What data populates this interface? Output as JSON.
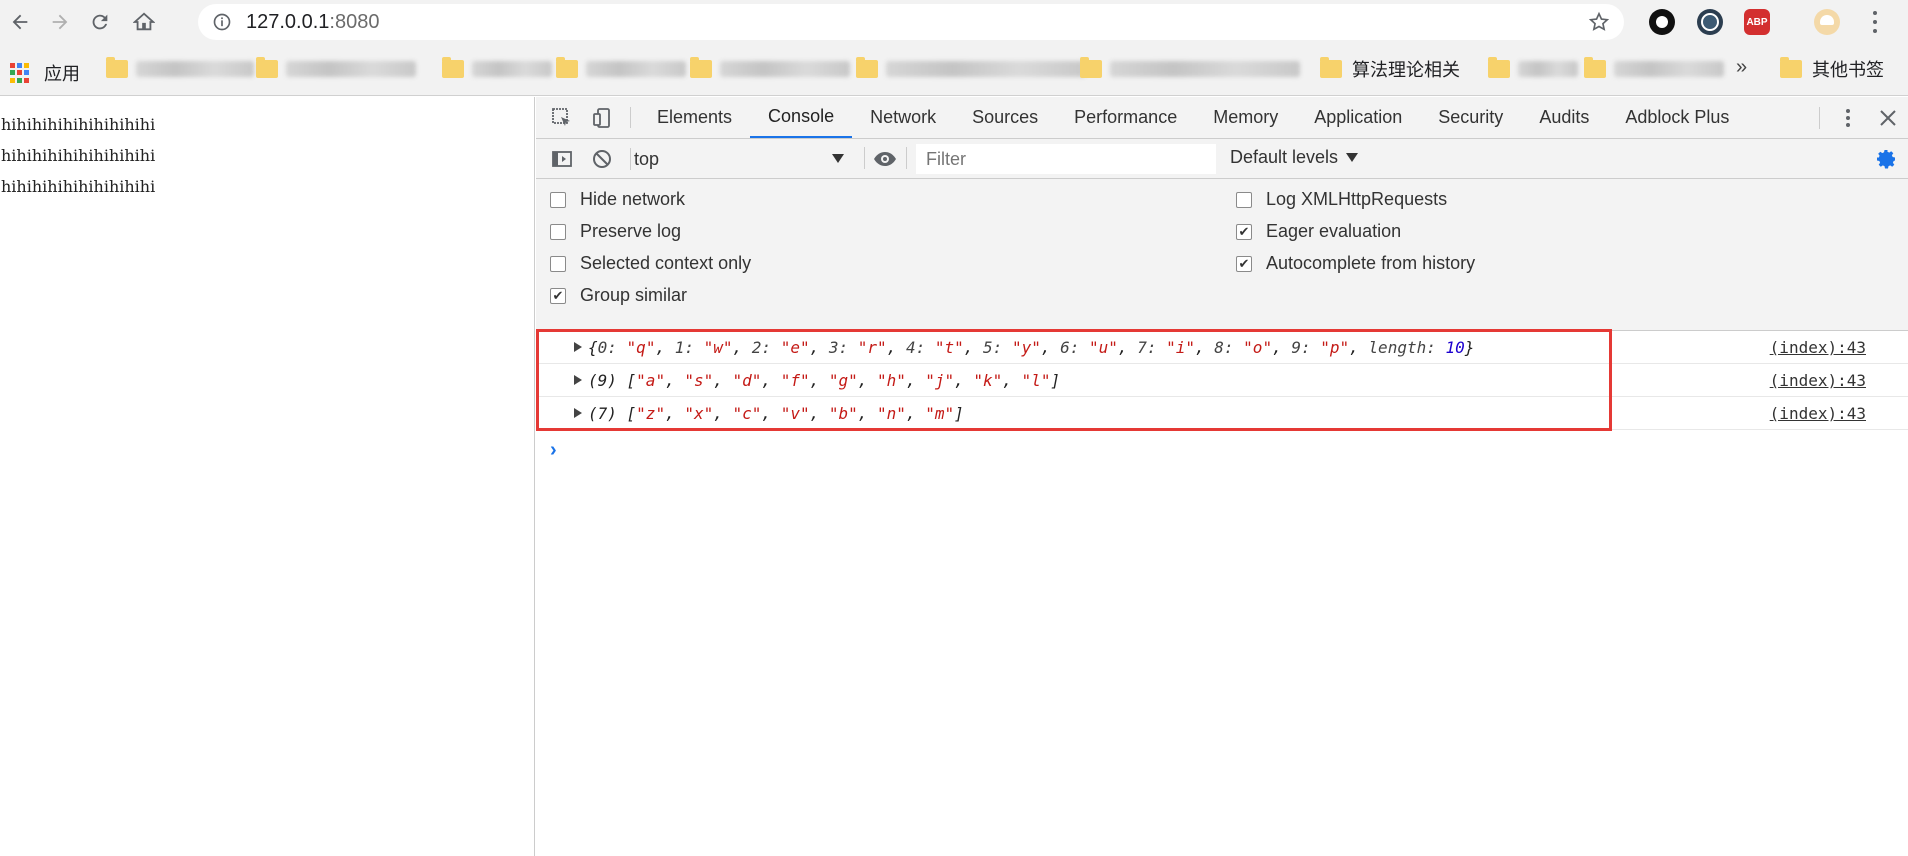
{
  "browser": {
    "url_host": "127.0.0.1",
    "url_port": ":8080"
  },
  "bookmarks": {
    "apps_label": "应用",
    "items": [
      {
        "label": "算法理论相关"
      },
      {
        "label": "其他书签"
      }
    ]
  },
  "page": {
    "lines": [
      "hihihihihihihihihihi",
      "hihihihihihihihihihi",
      "hihihihihihihihihihi"
    ]
  },
  "devtools": {
    "tabs": [
      "Elements",
      "Console",
      "Network",
      "Sources",
      "Performance",
      "Memory",
      "Application",
      "Security",
      "Audits",
      "Adblock Plus"
    ],
    "active_tab": "Console",
    "context": "top",
    "filter_placeholder": "Filter",
    "levels": "Default levels",
    "settings": {
      "hide_network": {
        "label": "Hide network",
        "checked": false
      },
      "preserve_log": {
        "label": "Preserve log",
        "checked": false
      },
      "selected_context_only": {
        "label": "Selected context only",
        "checked": false
      },
      "group_similar": {
        "label": "Group similar",
        "checked": true
      },
      "log_xhr": {
        "label": "Log XMLHttpRequests",
        "checked": false
      },
      "eager_evaluation": {
        "label": "Eager evaluation",
        "checked": true
      },
      "autocomplete_history": {
        "label": "Autocomplete from history",
        "checked": true
      }
    },
    "logs": [
      {
        "kind": "object",
        "entries": [
          [
            "0",
            "q"
          ],
          [
            "1",
            "w"
          ],
          [
            "2",
            "e"
          ],
          [
            "3",
            "r"
          ],
          [
            "4",
            "t"
          ],
          [
            "5",
            "y"
          ],
          [
            "6",
            "u"
          ],
          [
            "7",
            "i"
          ],
          [
            "8",
            "o"
          ],
          [
            "9",
            "p"
          ]
        ],
        "length_key": "length",
        "length_value": "10",
        "source": "(index):43"
      },
      {
        "kind": "array",
        "count": "(9)",
        "values": [
          "a",
          "s",
          "d",
          "f",
          "g",
          "h",
          "j",
          "k",
          "l"
        ],
        "source": "(index):43"
      },
      {
        "kind": "array",
        "count": "(7)",
        "values": [
          "z",
          "x",
          "c",
          "v",
          "b",
          "n",
          "m"
        ],
        "source": "(index):43"
      }
    ],
    "prompt": "›"
  },
  "colors": {
    "highlight": "#e53935",
    "string": "#c41a16",
    "number": "#1c00cf",
    "accent": "#1a73e8"
  }
}
